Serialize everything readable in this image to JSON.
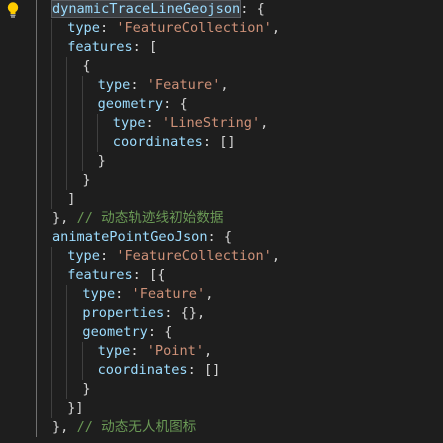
{
  "editor": {
    "lines": [
      {
        "indent": 1,
        "tokens": [
          {
            "t": "key",
            "v": "dynamicTraceLineGeojson",
            "sel": true
          },
          {
            "t": "pun",
            "v": ": {"
          }
        ]
      },
      {
        "indent": 2,
        "tokens": [
          {
            "t": "key",
            "v": "type"
          },
          {
            "t": "pun",
            "v": ": "
          },
          {
            "t": "str",
            "v": "'FeatureCollection'"
          },
          {
            "t": "pun",
            "v": ","
          }
        ]
      },
      {
        "indent": 2,
        "tokens": [
          {
            "t": "key",
            "v": "features"
          },
          {
            "t": "pun",
            "v": ": ["
          }
        ]
      },
      {
        "indent": 3,
        "tokens": [
          {
            "t": "pun",
            "v": "{"
          }
        ]
      },
      {
        "indent": 4,
        "tokens": [
          {
            "t": "key",
            "v": "type"
          },
          {
            "t": "pun",
            "v": ": "
          },
          {
            "t": "str",
            "v": "'Feature'"
          },
          {
            "t": "pun",
            "v": ","
          }
        ]
      },
      {
        "indent": 4,
        "tokens": [
          {
            "t": "key",
            "v": "geometry"
          },
          {
            "t": "pun",
            "v": ": {"
          }
        ]
      },
      {
        "indent": 5,
        "tokens": [
          {
            "t": "key",
            "v": "type"
          },
          {
            "t": "pun",
            "v": ": "
          },
          {
            "t": "str",
            "v": "'LineString'"
          },
          {
            "t": "pun",
            "v": ","
          }
        ]
      },
      {
        "indent": 5,
        "tokens": [
          {
            "t": "key",
            "v": "coordinates"
          },
          {
            "t": "pun",
            "v": ": []"
          }
        ]
      },
      {
        "indent": 4,
        "tokens": [
          {
            "t": "pun",
            "v": "}"
          }
        ]
      },
      {
        "indent": 3,
        "tokens": [
          {
            "t": "pun",
            "v": "}"
          }
        ]
      },
      {
        "indent": 2,
        "tokens": [
          {
            "t": "pun",
            "v": "]"
          }
        ]
      },
      {
        "indent": 1,
        "tokens": [
          {
            "t": "pun",
            "v": "}, "
          },
          {
            "t": "cmt",
            "v": "// 动态轨迹线初始数据"
          }
        ]
      },
      {
        "indent": 1,
        "tokens": [
          {
            "t": "key",
            "v": "animatePointGeoJson"
          },
          {
            "t": "pun",
            "v": ": {"
          }
        ]
      },
      {
        "indent": 2,
        "tokens": [
          {
            "t": "key",
            "v": "type"
          },
          {
            "t": "pun",
            "v": ": "
          },
          {
            "t": "str",
            "v": "'FeatureCollection'"
          },
          {
            "t": "pun",
            "v": ","
          }
        ]
      },
      {
        "indent": 2,
        "tokens": [
          {
            "t": "key",
            "v": "features"
          },
          {
            "t": "pun",
            "v": ": [{"
          }
        ]
      },
      {
        "indent": 3,
        "tokens": [
          {
            "t": "key",
            "v": "type"
          },
          {
            "t": "pun",
            "v": ": "
          },
          {
            "t": "str",
            "v": "'Feature'"
          },
          {
            "t": "pun",
            "v": ","
          }
        ]
      },
      {
        "indent": 3,
        "tokens": [
          {
            "t": "key",
            "v": "properties"
          },
          {
            "t": "pun",
            "v": ": {},"
          }
        ]
      },
      {
        "indent": 3,
        "tokens": [
          {
            "t": "key",
            "v": "geometry"
          },
          {
            "t": "pun",
            "v": ": {"
          }
        ]
      },
      {
        "indent": 4,
        "tokens": [
          {
            "t": "key",
            "v": "type"
          },
          {
            "t": "pun",
            "v": ": "
          },
          {
            "t": "str",
            "v": "'Point'"
          },
          {
            "t": "pun",
            "v": ","
          }
        ]
      },
      {
        "indent": 4,
        "tokens": [
          {
            "t": "key",
            "v": "coordinates"
          },
          {
            "t": "pun",
            "v": ": []"
          }
        ]
      },
      {
        "indent": 3,
        "tokens": [
          {
            "t": "pun",
            "v": "}"
          }
        ]
      },
      {
        "indent": 2,
        "tokens": [
          {
            "t": "pun",
            "v": "}]"
          }
        ]
      },
      {
        "indent": 1,
        "tokens": [
          {
            "t": "pun",
            "v": "}, "
          },
          {
            "t": "cmt",
            "v": "// 动态无人机图标"
          }
        ]
      }
    ]
  },
  "colors": {
    "background": "#1e1e1e",
    "property": "#9cdcfe",
    "string": "#ce9178",
    "comment": "#6a9955",
    "punctuation": "#d4d4d4",
    "lightbulb": "#ffcc00"
  },
  "icons": {
    "gutter": "lightbulb-icon"
  }
}
